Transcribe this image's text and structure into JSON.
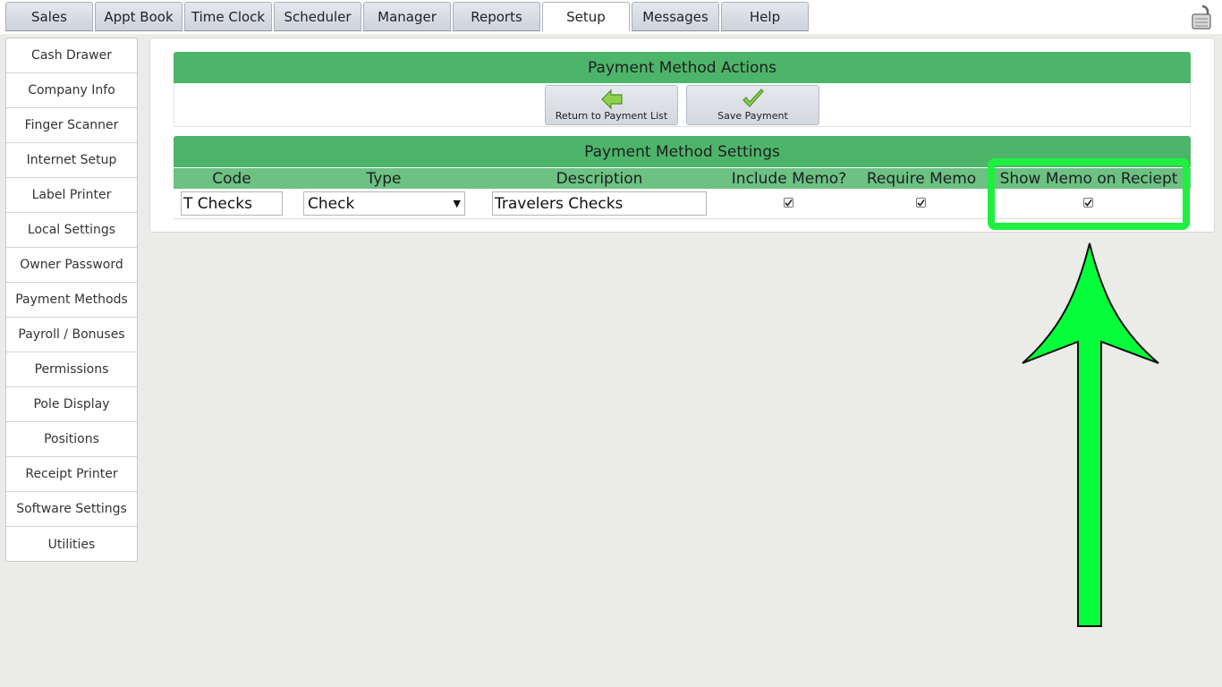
{
  "nav": {
    "tabs": [
      {
        "label": "Sales"
      },
      {
        "label": "Appt Book"
      },
      {
        "label": "Time Clock"
      },
      {
        "label": "Scheduler"
      },
      {
        "label": "Manager"
      },
      {
        "label": "Reports"
      },
      {
        "label": "Setup"
      },
      {
        "label": "Messages"
      },
      {
        "label": "Help"
      }
    ],
    "active_tab": "Setup",
    "lock_icon": "padlock-icon"
  },
  "sidebar": {
    "items": [
      {
        "label": "Cash Drawer"
      },
      {
        "label": "Company Info"
      },
      {
        "label": "Finger Scanner"
      },
      {
        "label": "Internet Setup"
      },
      {
        "label": "Label Printer"
      },
      {
        "label": "Local Settings"
      },
      {
        "label": "Owner Password"
      },
      {
        "label": "Payment Methods"
      },
      {
        "label": "Payroll / Bonuses"
      },
      {
        "label": "Permissions"
      },
      {
        "label": "Pole Display"
      },
      {
        "label": "Positions"
      },
      {
        "label": "Receipt Printer"
      },
      {
        "label": "Software Settings"
      },
      {
        "label": "Utilities"
      }
    ]
  },
  "actions": {
    "header": "Payment Method Actions",
    "return_label": "Return to Payment List",
    "save_label": "Save Payment"
  },
  "settings": {
    "header": "Payment Method Settings",
    "columns": {
      "code": "Code",
      "type": "Type",
      "description": "Description",
      "include_memo": "Include Memo?",
      "require_memo": "Require Memo",
      "show_memo": "Show Memo on Reciept"
    },
    "row": {
      "code": "T Checks",
      "type": "Check",
      "description": "Travelers Checks",
      "include_memo": true,
      "require_memo": true,
      "show_memo": true
    }
  },
  "colors": {
    "header_green": "#4db56a",
    "column_green": "#6cc183",
    "highlight": "#1ff040"
  }
}
